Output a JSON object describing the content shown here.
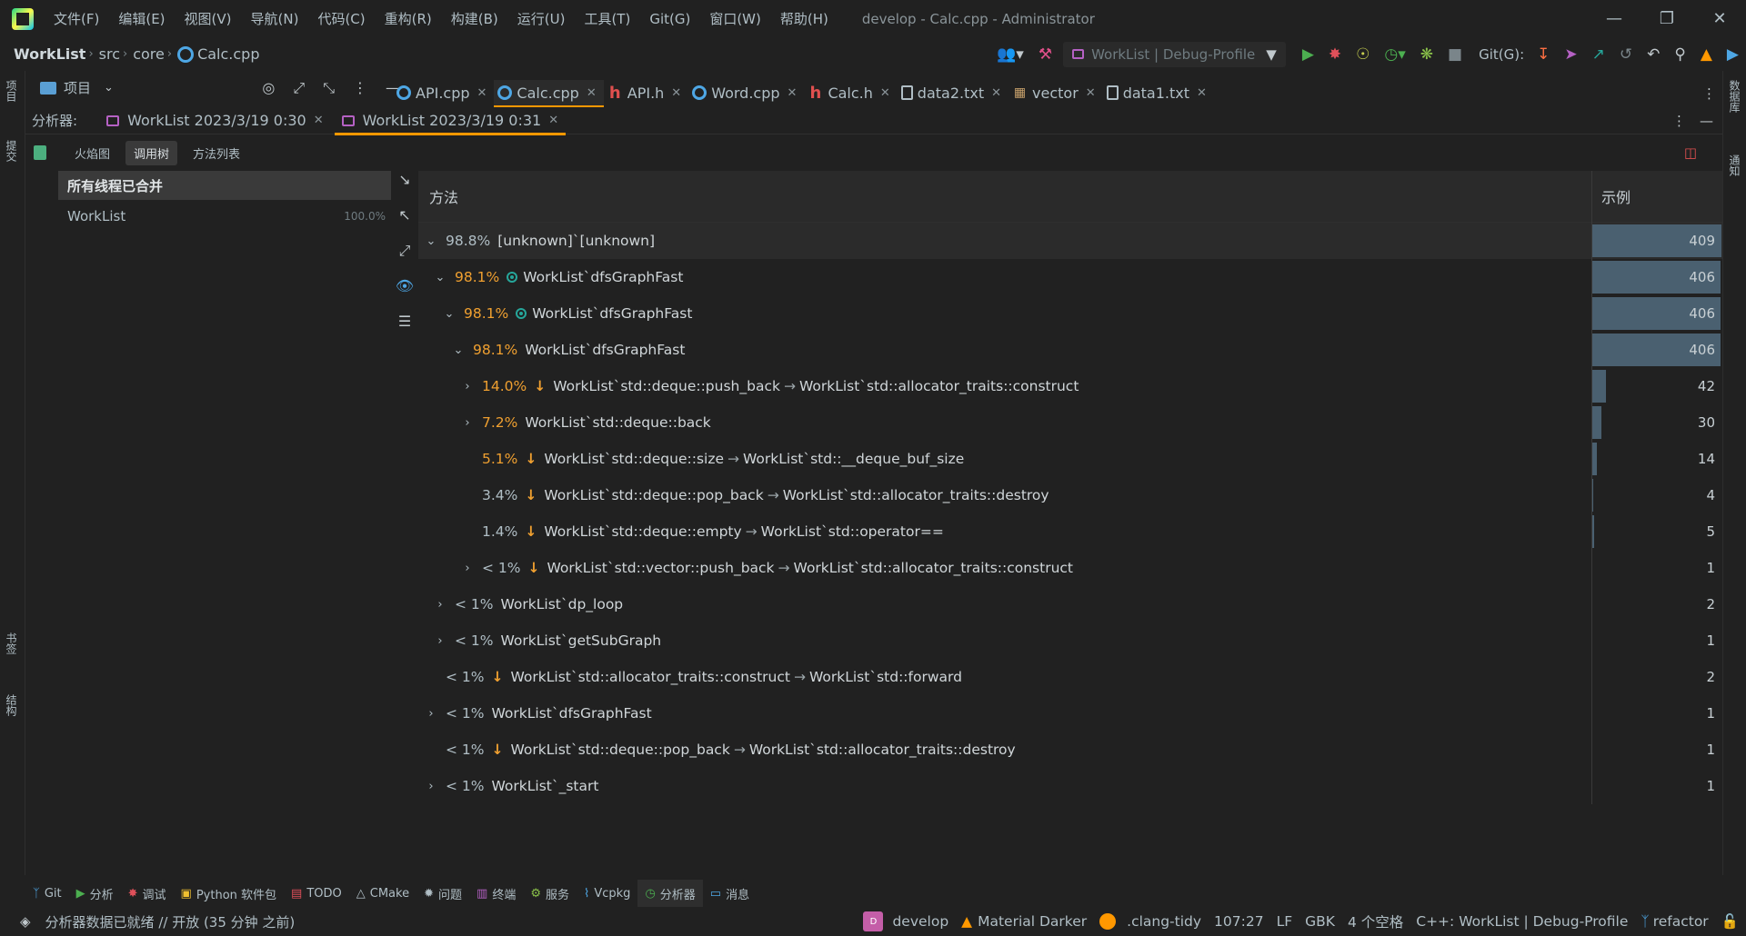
{
  "menu": [
    "文件(F)",
    "编辑(E)",
    "视图(V)",
    "导航(N)",
    "代码(C)",
    "重构(R)",
    "构建(B)",
    "运行(U)",
    "工具(T)",
    "Git(G)",
    "窗口(W)",
    "帮助(H)"
  ],
  "window_title": "develop - Calc.cpp - Administrator",
  "breadcrumb": {
    "project": "WorkList",
    "dir1": "src",
    "dir2": "core",
    "file": "Calc.cpp"
  },
  "run_config": "WorkList | Debug-Profile",
  "git_label": "Git(G):",
  "project_panel": {
    "title": "项目"
  },
  "editor_tabs": [
    {
      "label": "API.cpp",
      "icon": "cpp-file-icon"
    },
    {
      "label": "Calc.cpp",
      "icon": "cpp-file-icon"
    },
    {
      "label": "API.h",
      "icon": "header-file-icon"
    },
    {
      "label": "Word.cpp",
      "icon": "cpp-file-icon"
    },
    {
      "label": "Calc.h",
      "icon": "header-file-icon"
    },
    {
      "label": "data2.txt",
      "icon": "text-file-icon"
    },
    {
      "label": "vector",
      "icon": "library-icon"
    },
    {
      "label": "data1.txt",
      "icon": "text-file-icon"
    }
  ],
  "profiler": {
    "label": "分析器:",
    "tabs": [
      "WorkList 2023/3/19 0:30",
      "WorkList 2023/3/19 0:31"
    ],
    "subtabs": [
      "火焰图",
      "调用树",
      "方法列表"
    ],
    "threads_header": "所有线程已合并",
    "threads": [
      {
        "name": "WorkList",
        "pct": "100.0%"
      }
    ],
    "col_method": "方法",
    "col_samples": "示例"
  },
  "call_tree": [
    {
      "chev": "open",
      "pct": "98.8%",
      "pct_color": "grey",
      "down": false,
      "func_icon": false,
      "name": "[unknown]`[unknown]",
      "callee": "",
      "samples": "409",
      "ratio": 1.0
    },
    {
      "chev": "open",
      "pct": "98.1%",
      "pct_color": "orange",
      "down": false,
      "func_icon": true,
      "name": "WorkList`dfsGraphFast",
      "callee": "",
      "samples": "406",
      "ratio": 0.993
    },
    {
      "chev": "open",
      "pct": "98.1%",
      "pct_color": "orange",
      "down": false,
      "func_icon": true,
      "name": "WorkList`dfsGraphFast",
      "callee": "",
      "samples": "406",
      "ratio": 0.993
    },
    {
      "chev": "open",
      "pct": "98.1%",
      "pct_color": "orange",
      "down": false,
      "func_icon": false,
      "name": "WorkList`dfsGraphFast",
      "callee": "",
      "samples": "406",
      "ratio": 0.993
    },
    {
      "chev": "closed",
      "pct": "14.0%",
      "pct_color": "orange",
      "down": true,
      "func_icon": false,
      "name": "WorkList`std::deque::push_back",
      "callee": "WorkList`std::allocator_traits::construct",
      "samples": "42",
      "ratio": 0.103
    },
    {
      "chev": "closed",
      "pct": "7.2%",
      "pct_color": "orange",
      "down": false,
      "func_icon": false,
      "name": "WorkList`std::deque::back",
      "callee": "",
      "samples": "30",
      "ratio": 0.073
    },
    {
      "chev": "none",
      "pct": "5.1%",
      "pct_color": "orange",
      "down": true,
      "func_icon": false,
      "name": "WorkList`std::deque::size",
      "callee": "WorkList`std::__deque_buf_size",
      "samples": "14",
      "ratio": 0.034
    },
    {
      "chev": "none",
      "pct": "3.4%",
      "pct_color": "grey",
      "down": true,
      "func_icon": false,
      "name": "WorkList`std::deque::pop_back",
      "callee": "WorkList`std::allocator_traits::destroy",
      "samples": "4",
      "ratio": 0.01
    },
    {
      "chev": "none",
      "pct": "1.4%",
      "pct_color": "grey",
      "down": true,
      "func_icon": false,
      "name": "WorkList`std::deque::empty",
      "callee": "WorkList`std::operator==",
      "samples": "5",
      "ratio": 0.012
    },
    {
      "chev": "closed",
      "pct": "< 1%",
      "pct_color": "grey",
      "down": true,
      "func_icon": false,
      "name": "WorkList`std::vector::push_back",
      "callee": "WorkList`std::allocator_traits::construct",
      "samples": "1",
      "ratio": 0.0
    },
    {
      "chev": "closed",
      "pct": "< 1%",
      "pct_color": "grey",
      "down": false,
      "func_icon": false,
      "name": "WorkList`dp_loop",
      "callee": "",
      "samples": "2",
      "ratio": 0.0
    },
    {
      "chev": "closed",
      "pct": "< 1%",
      "pct_color": "grey",
      "down": false,
      "func_icon": false,
      "name": "WorkList`getSubGraph",
      "callee": "",
      "samples": "1",
      "ratio": 0.0
    },
    {
      "chev": "none",
      "pct": "< 1%",
      "pct_color": "grey",
      "down": true,
      "func_icon": false,
      "name": "WorkList`std::allocator_traits::construct",
      "callee": "WorkList`std::forward",
      "samples": "2",
      "ratio": 0.0
    },
    {
      "chev": "closed",
      "pct": "< 1%",
      "pct_color": "grey",
      "down": false,
      "func_icon": false,
      "name": "WorkList`dfsGraphFast",
      "callee": "",
      "samples": "1",
      "ratio": 0.0
    },
    {
      "chev": "none",
      "pct": "< 1%",
      "pct_color": "grey",
      "down": true,
      "func_icon": false,
      "name": "WorkList`std::deque::pop_back",
      "callee": "WorkList`std::allocator_traits::destroy",
      "samples": "1",
      "ratio": 0.0
    },
    {
      "chev": "closed",
      "pct": "< 1%",
      "pct_color": "grey",
      "down": false,
      "func_icon": false,
      "name": "WorkList`_start",
      "callee": "",
      "samples": "1",
      "ratio": 0.0
    }
  ],
  "tool_windows": [
    {
      "label": "Git",
      "icon": "branch-icon"
    },
    {
      "label": "分析",
      "icon": "run-icon"
    },
    {
      "label": "调试",
      "icon": "bug-icon"
    },
    {
      "label": "Python 软件包",
      "icon": "package-icon"
    },
    {
      "label": "TODO",
      "icon": "todo-icon"
    },
    {
      "label": "CMake",
      "icon": "cmake-icon"
    },
    {
      "label": "问题",
      "icon": "problems-icon"
    },
    {
      "label": "终端",
      "icon": "terminal-icon"
    },
    {
      "label": "服务",
      "icon": "services-icon"
    },
    {
      "label": "Vcpkg",
      "icon": "vcpkg-icon"
    },
    {
      "label": "分析器",
      "icon": "profiler-icon"
    },
    {
      "label": "消息",
      "icon": "messages-icon"
    }
  ],
  "left_strip": [
    "项目",
    "提交",
    "书签",
    "结构"
  ],
  "right_strip": [
    "数据库",
    "通知"
  ],
  "status": {
    "message": "分析器数据已就绪 // 开放 (35 分钟 之前)",
    "branch_badge": "D",
    "branch": "develop",
    "theme": "Material Darker",
    "linter": ".clang-tidy",
    "position": "107:27",
    "line_sep": "LF",
    "encoding": "GBK",
    "indent": "4 个空格",
    "context": "C++: WorkList | Debug-Profile",
    "vcs_branch": "refactor"
  },
  "colors": {
    "accent": "#ff9800",
    "bg": "#212121",
    "bar": "#4a6070",
    "pct_orange": "#f0a030"
  }
}
